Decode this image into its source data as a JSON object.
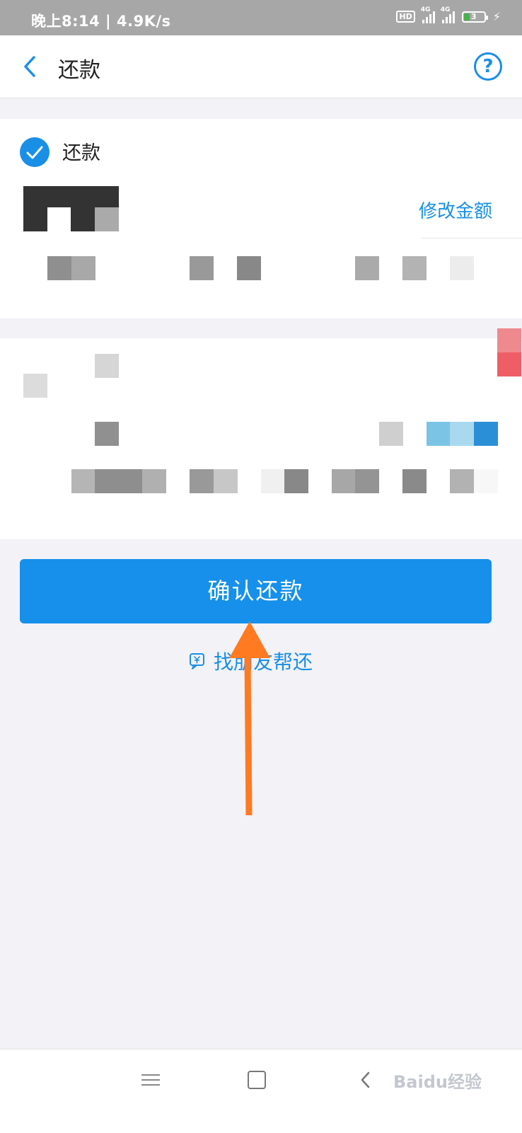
{
  "status_bar": {
    "time_speed": "晚上8:14 | 4.9K/s",
    "hd": "HD",
    "network1": "4G",
    "network2": "4G",
    "battery": "3"
  },
  "nav": {
    "title": "还款",
    "help": "?"
  },
  "repay_card": {
    "option_label": "还款",
    "modify_amount": "修改金额"
  },
  "actions": {
    "confirm": "确认还款",
    "friend_help": "找朋友帮还"
  },
  "watermark": "Baidu经验",
  "colors": {
    "primary": "#1690ea",
    "arrow": "#ff7a21",
    "background": "#f2f2f7"
  },
  "icons": {
    "back": "chevron-left-icon",
    "help": "question-circle-icon",
    "check": "checkmark-icon",
    "friend": "yuan-chat-icon",
    "menu": "menu-icon",
    "home": "square-home-icon",
    "nav_back": "triangle-back-icon"
  }
}
